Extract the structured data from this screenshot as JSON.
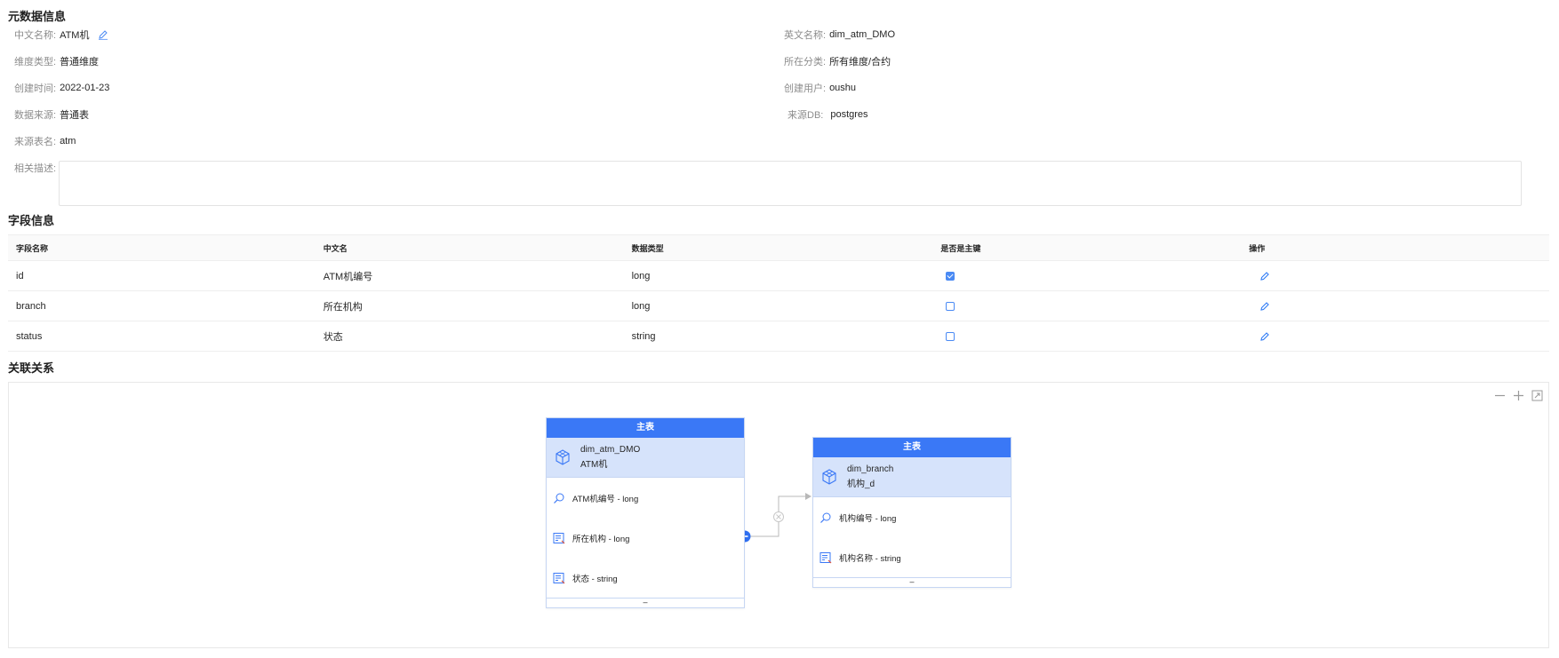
{
  "metadata": {
    "title": "元数据信息",
    "fields": {
      "chinese_name": {
        "label": "中文名称:",
        "value": "ATM机"
      },
      "english_name": {
        "label": "英文名称:",
        "value": "dim_atm_DMO"
      },
      "dimension_type": {
        "label": "维度类型:",
        "value": "普通维度"
      },
      "category": {
        "label": "所在分类:",
        "value": "所有维度/合约"
      },
      "created_at": {
        "label": "创建时间:",
        "value": "2022-01-23"
      },
      "created_by": {
        "label": "创建用户:",
        "value": "oushu"
      },
      "data_source": {
        "label": "数据来源:",
        "value": "普通表"
      },
      "source_db": {
        "label": "来源DB:",
        "value": "postgres"
      },
      "source_table": {
        "label": "来源表名:",
        "value": "atm"
      },
      "description": {
        "label": "相关描述:",
        "value": ""
      }
    }
  },
  "fields_section": {
    "title": "字段信息",
    "columns": [
      "字段名称",
      "中文名",
      "数据类型",
      "是否是主键",
      "操作"
    ],
    "rows": [
      {
        "name": "id",
        "cn": "ATM机编号",
        "type": "long",
        "is_pk": true
      },
      {
        "name": "branch",
        "cn": "所在机构",
        "type": "long",
        "is_pk": false
      },
      {
        "name": "status",
        "cn": "状态",
        "type": "string",
        "is_pk": false
      }
    ]
  },
  "relations": {
    "title": "关联关系",
    "zoom_controls": [
      "minus-icon",
      "plus-icon",
      "fit-screen-icon"
    ],
    "nodes": [
      {
        "header": "主表",
        "name": "dim_atm_DMO",
        "cn_name": "ATM机",
        "fields": [
          {
            "icon": "search-key-icon",
            "label": "ATM机编号 - long"
          },
          {
            "icon": "field-list-icon",
            "label": "所在机构 - long"
          },
          {
            "icon": "field-list-icon",
            "label": "状态 - string"
          }
        ],
        "footer": "–"
      },
      {
        "header": "主表",
        "name": "dim_branch",
        "cn_name": "机构_d",
        "fields": [
          {
            "icon": "search-key-icon",
            "label": "机构编号 - long"
          },
          {
            "icon": "field-list-icon",
            "label": "机构名称 - string"
          }
        ],
        "footer": "–"
      }
    ]
  },
  "colors": {
    "accent": "#3a78f6",
    "node_title_bg": "#d6e3fb",
    "label_gray": "#8c8c8c"
  }
}
